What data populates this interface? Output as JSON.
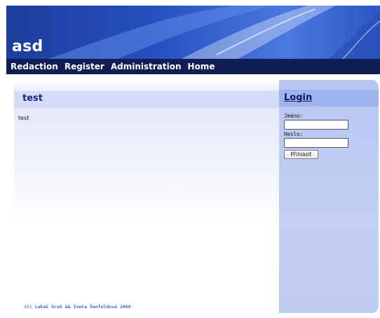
{
  "site": {
    "title": "asd"
  },
  "nav": {
    "items": [
      {
        "label": "Redaction"
      },
      {
        "label": "Register"
      },
      {
        "label": "Administration"
      },
      {
        "label": "Home"
      }
    ]
  },
  "main": {
    "title": "test",
    "body": "test",
    "footer": "(C) Lukáš Greň && Iveta Šenfeldová 2008"
  },
  "login": {
    "title": "Login",
    "username_label": "Jméno:",
    "username_value": "",
    "password_label": "Heslo:",
    "password_value": "",
    "submit_label": "Přihlásit"
  },
  "colors": {
    "header_blue": "#2650c0",
    "nav_dark": "#0f1f55",
    "sidebar": "#c3cff5",
    "title_text": "#1a2a78"
  }
}
